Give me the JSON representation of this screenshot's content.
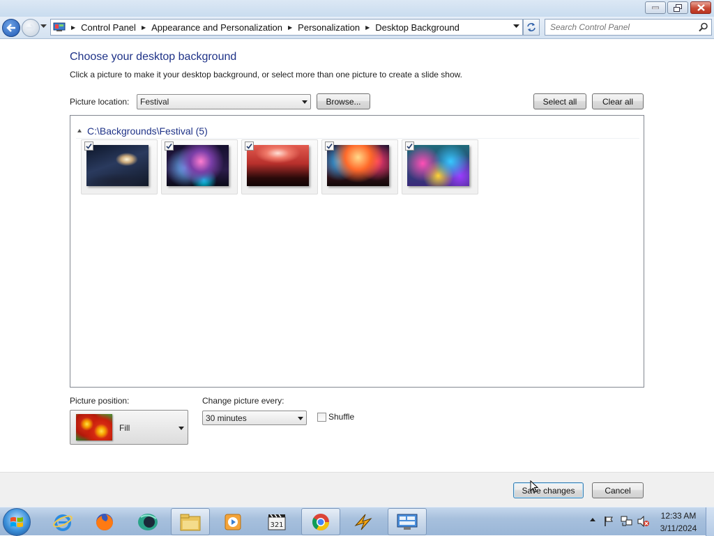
{
  "navigation": {
    "breadcrumbs": [
      "Control Panel",
      "Appearance and Personalization",
      "Personalization",
      "Desktop Background"
    ],
    "search_placeholder": "Search Control Panel"
  },
  "main": {
    "title": "Choose your desktop background",
    "subtitle": "Click a picture to make it your desktop background, or select more than one picture to create a slide show.",
    "picture_location_label": "Picture location:",
    "picture_location_value": "Festival",
    "browse_label": "Browse...",
    "select_all_label": "Select all",
    "clear_all_label": "Clear all",
    "group_title": "C:\\Backgrounds\\Festival (5)",
    "pictures": [
      {
        "checked": true,
        "icon": "concert-stage-photo"
      },
      {
        "checked": true,
        "icon": "fireworks-crowd-photo"
      },
      {
        "checked": true,
        "icon": "red-stage-crowd-photo"
      },
      {
        "checked": true,
        "icon": "stage-lights-photo"
      },
      {
        "checked": true,
        "icon": "color-powder-crowd-photo"
      }
    ],
    "picture_position_label": "Picture position:",
    "picture_position_value": "Fill",
    "change_every_label": "Change picture every:",
    "change_every_value": "30 minutes",
    "shuffle_label": "Shuffle",
    "shuffle_checked": false
  },
  "footer": {
    "save_label": "Save changes",
    "cancel_label": "Cancel"
  },
  "taskbar": {
    "apps": [
      "internet-explorer-icon",
      "firefox-icon",
      "app-globe-icon",
      "file-explorer-icon",
      "media-player-icon",
      "media-player-classic-icon",
      "chrome-icon",
      "winamp-icon",
      "control-panel-icon"
    ],
    "time": "12:33 AM",
    "date": "3/11/2024"
  },
  "colors": {
    "title_blue": "#1e3287",
    "taskbar": "#a7c0dd",
    "close_red": "#c74a36"
  }
}
